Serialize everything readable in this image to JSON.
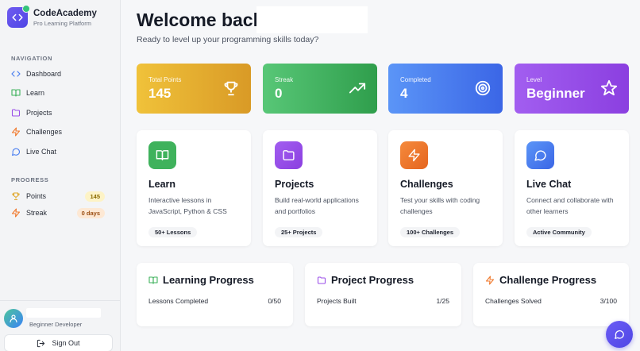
{
  "brand": {
    "title": "CodeAcademy",
    "subtitle": "Pro Learning Platform"
  },
  "sidebar": {
    "nav_label": "NAVIGATION",
    "nav": [
      {
        "label": "Dashboard",
        "icon": "code-icon"
      },
      {
        "label": "Learn",
        "icon": "book-icon"
      },
      {
        "label": "Projects",
        "icon": "folder-icon"
      },
      {
        "label": "Challenges",
        "icon": "bolt-icon"
      },
      {
        "label": "Live Chat",
        "icon": "chat-icon"
      }
    ],
    "progress_label": "PROGRESS",
    "progress": [
      {
        "label": "Points",
        "badge": "145",
        "icon": "trophy-icon"
      },
      {
        "label": "Streak",
        "badge": "0 days",
        "icon": "bolt-icon"
      }
    ],
    "user": {
      "role": "Beginner Developer"
    },
    "signout_label": "Sign Out"
  },
  "main": {
    "title": "Welcome back",
    "subtitle": "Ready to level up your programming skills today?",
    "stats": [
      {
        "label": "Total Points",
        "value": "145",
        "icon": "trophy-icon",
        "color": "#e0a72a"
      },
      {
        "label": "Streak",
        "value": "0",
        "icon": "trending-up-icon",
        "color": "#3fb25c"
      },
      {
        "label": "Completed",
        "value": "4",
        "icon": "target-icon",
        "color": "#4a7ff0"
      },
      {
        "label": "Level",
        "value": "Beginner",
        "icon": "star-icon",
        "color": "#9b4fe8"
      }
    ],
    "cards": [
      {
        "title": "Learn",
        "desc": "Interactive lessons in JavaScript, Python & CSS",
        "tag": "50+ Lessons",
        "icon": "book-icon",
        "color": "#3fb25c"
      },
      {
        "title": "Projects",
        "desc": "Build real-world applications and portfolios",
        "tag": "25+ Projects",
        "icon": "folder-icon",
        "color": "#9b4fe8"
      },
      {
        "title": "Challenges",
        "desc": "Test your skills with coding challenges",
        "tag": "100+ Challenges",
        "icon": "bolt-icon",
        "color": "#f07a2e"
      },
      {
        "title": "Live Chat",
        "desc": "Connect and collaborate with other learners",
        "tag": "Active Community",
        "icon": "chat-icon",
        "color": "#4a7ff0"
      }
    ],
    "progress": [
      {
        "title": "Learning Progress",
        "label": "Lessons Completed",
        "value": "0/50",
        "icon": "book-icon",
        "color": "#3fb25c"
      },
      {
        "title": "Project Progress",
        "label": "Projects Built",
        "value": "1/25",
        "icon": "folder-icon",
        "color": "#9b4fe8"
      },
      {
        "title": "Challenge Progress",
        "label": "Challenges Solved",
        "value": "3/100",
        "icon": "bolt-icon",
        "color": "#f07a2e"
      }
    ]
  },
  "fab": {
    "icon": "chat-icon"
  }
}
